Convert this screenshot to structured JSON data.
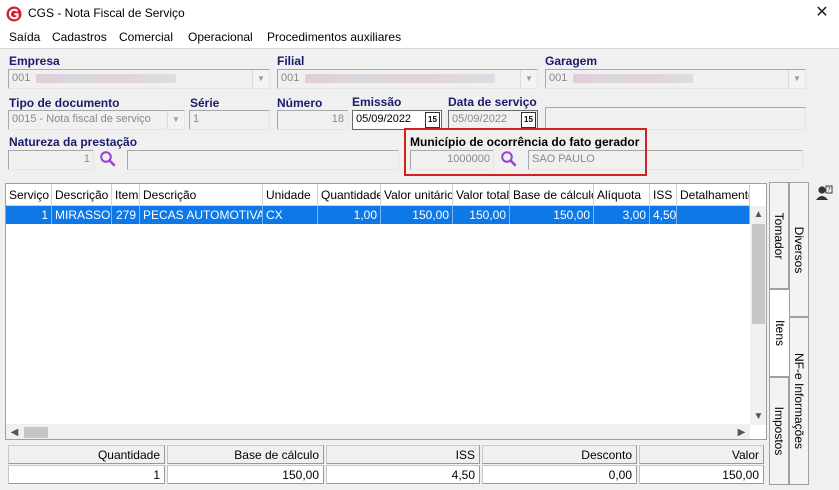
{
  "window": {
    "title": "CGS - Nota Fiscal de Serviço",
    "close_glyph": "✕",
    "icon": "cgs-logo-icon"
  },
  "menu": [
    "Saída",
    "Cadastros",
    "Comercial",
    "Operacional",
    "Procedimentos auxiliares"
  ],
  "form": {
    "empresa": {
      "label": "Empresa",
      "value": "001"
    },
    "filial": {
      "label": "Filial",
      "value": "001"
    },
    "garagem": {
      "label": "Garagem",
      "value": "001"
    },
    "tipo_documento": {
      "label": "Tipo de documento",
      "value": "0015 - Nota fiscal de serviço"
    },
    "serie": {
      "label": "Série",
      "value": "1"
    },
    "numero": {
      "label": "Número",
      "value": "18"
    },
    "emissao": {
      "label": "Emissão",
      "value": "05/09/2022",
      "calendar": "15"
    },
    "data_servico": {
      "label": "Data de serviço",
      "value": "05/09/2022",
      "calendar": "15"
    },
    "natureza": {
      "label": "Natureza da prestação",
      "code": "1",
      "description": ""
    },
    "municipio": {
      "label": "Município de ocorrência do fato gerador",
      "code": "1000000",
      "name": "SAO PAULO"
    }
  },
  "grid": {
    "columns": [
      "Serviço",
      "Descrição",
      "Item",
      "Descrição",
      "Unidade",
      "Quantidade",
      "Valor unitário",
      "Valor total",
      "Base de cálculo",
      "Alíquota",
      "ISS",
      "Detalhamento"
    ],
    "rows": [
      [
        "1",
        "MIRASSOL",
        "279",
        "PECAS AUTOMOTIVAS",
        "CX",
        "1,00",
        "150,00",
        "150,00",
        "150,00",
        "3,00",
        "4,50",
        ""
      ]
    ],
    "scroll_up": "▲",
    "scroll_down": "▼",
    "scroll_left": "◀",
    "scroll_right": "▶"
  },
  "totals": {
    "labels": [
      "Quantidade",
      "Base de cálculo",
      "ISS",
      "Desconto",
      "Valor"
    ],
    "values": [
      "1",
      "150,00",
      "4,50",
      "0,00",
      "150,00"
    ]
  },
  "tabs": {
    "left_column": [
      "Tomador",
      "Itens",
      "Impostos"
    ],
    "right_column": [
      "Diversos",
      "NF-e Informações"
    ],
    "active": "Itens"
  }
}
